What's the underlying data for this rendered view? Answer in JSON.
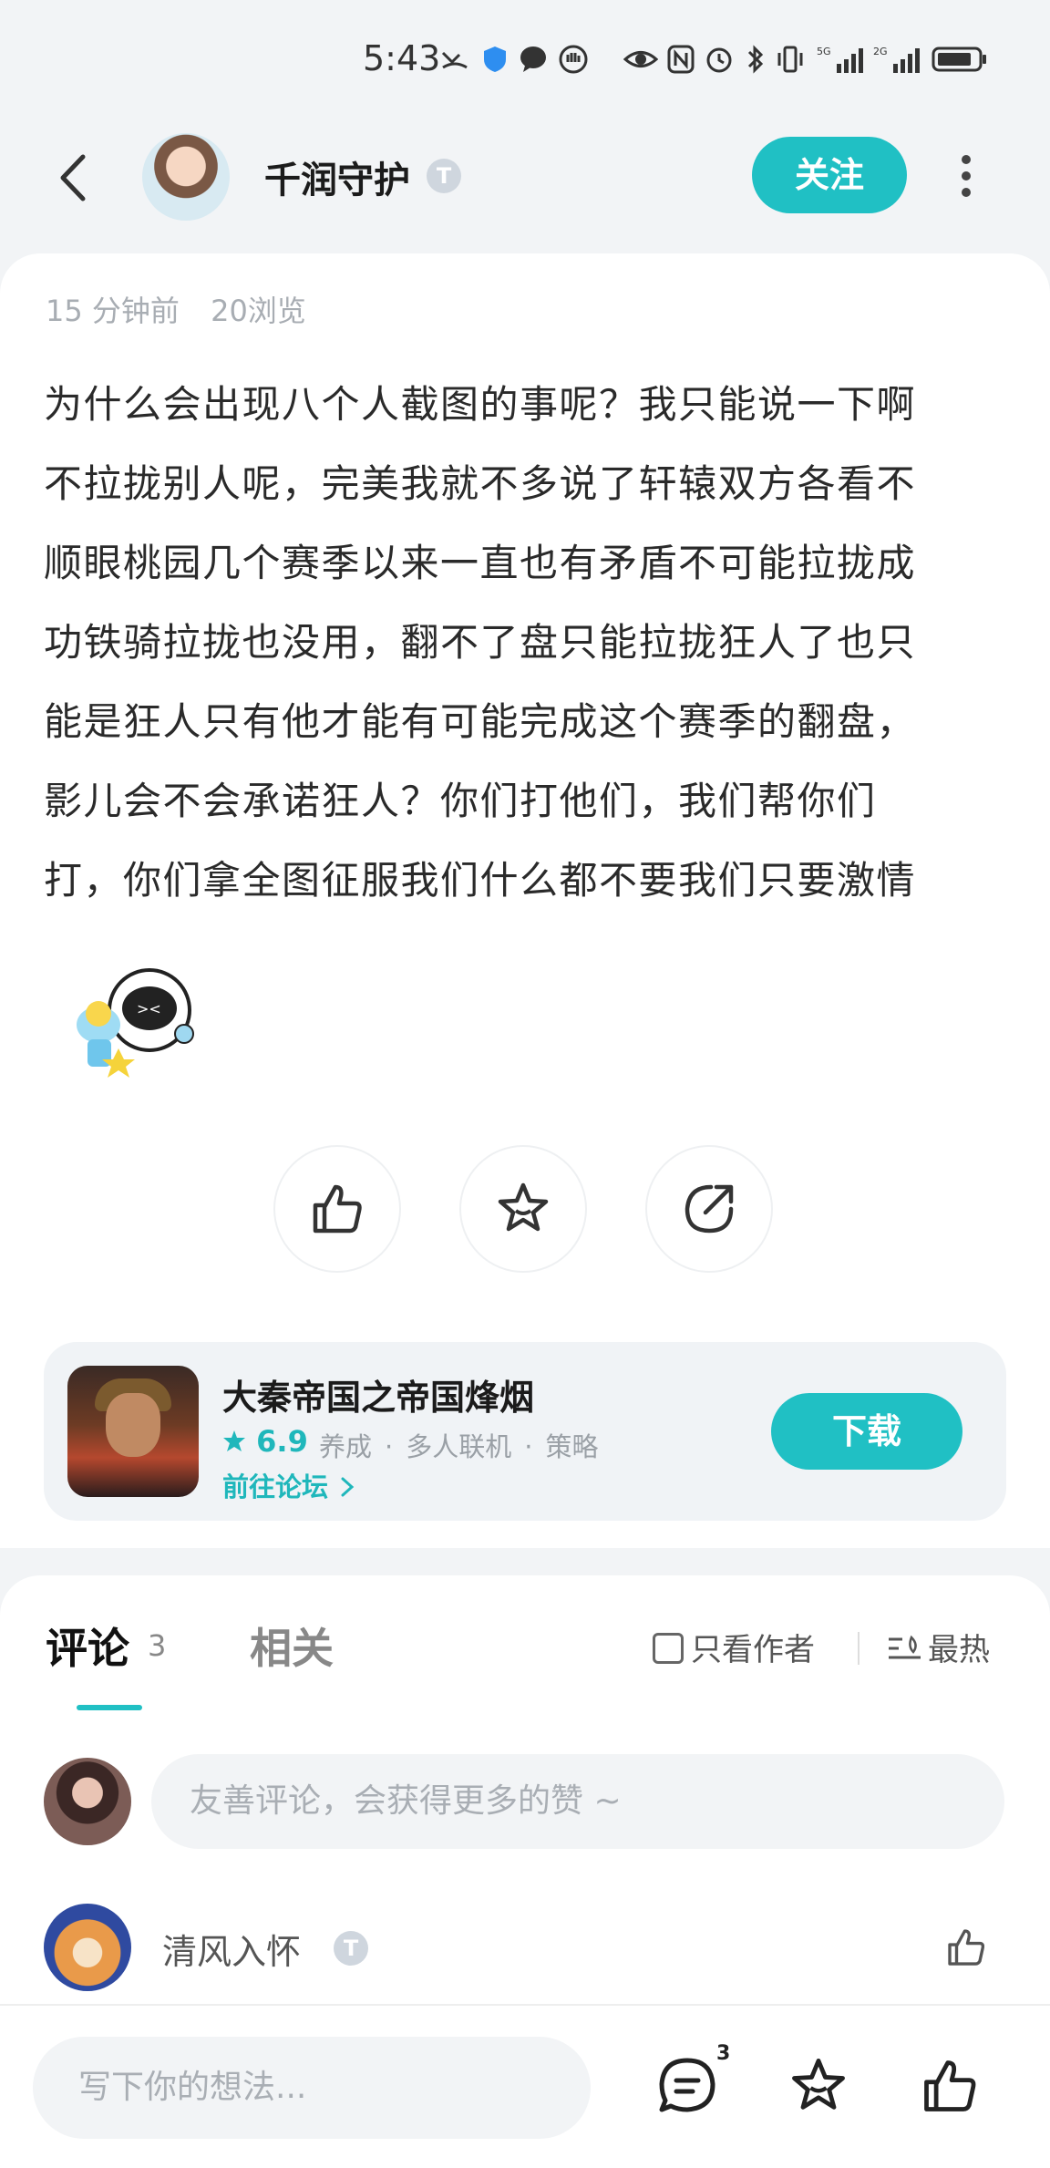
{
  "status_bar": {
    "time": "5:43"
  },
  "header": {
    "author_name": "千润守护",
    "level_badge": "T",
    "follow_label": "关注"
  },
  "post": {
    "time_ago": "15 分钟前",
    "views": "20浏览",
    "lines": [
      "为什么会出现八个人截图的事呢？我只能说一下啊",
      "不拉拢别人呢，完美我就不多说了轩辕双方各看不",
      "顺眼桃园几个赛季以来一直也有矛盾不可能拉拢成",
      "功铁骑拉拢也没用，翻不了盘只能拉拢狂人了也只",
      "能是狂人只有他才能有可能完成这个赛季的翻盘，",
      "影儿会不会承诺狂人？你们打他们，我们帮你们",
      "打，你们拿全图征服我们什么都不要我们只要激情"
    ]
  },
  "game": {
    "title": "大秦帝国之帝国烽烟",
    "rating": "6.9",
    "tags": [
      "养成",
      "多人联机",
      "策略"
    ],
    "forum_link": "前往论坛",
    "download_label": "下载"
  },
  "comments": {
    "tab_comment": "评论",
    "comment_count": "3",
    "tab_related": "相关",
    "only_author": "只看作者",
    "sort_label": "最热",
    "input_placeholder": "友善评论，会获得更多的赞 ~",
    "items": [
      {
        "name": "清风入怀"
      }
    ]
  },
  "bottom_bar": {
    "input_placeholder": "写下你的想法...",
    "comment_badge": "3"
  },
  "colors": {
    "accent": "#20c0c4"
  }
}
